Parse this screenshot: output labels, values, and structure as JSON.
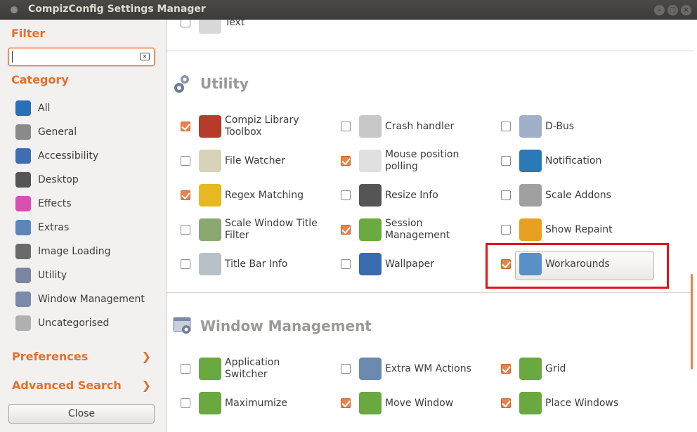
{
  "window": {
    "title": "CompizConfig Settings Manager",
    "buttons": {
      "minimize": "–",
      "maximize": "□",
      "close": "×"
    }
  },
  "sidebar": {
    "filter_heading": "Filter",
    "filter_value": "",
    "category_heading": "Category",
    "categories": [
      {
        "label": "All",
        "icon": "globe-icon",
        "color": "#2a6fb8"
      },
      {
        "label": "General",
        "icon": "gear-icon",
        "color": "#8a8a8a"
      },
      {
        "label": "Accessibility",
        "icon": "accessibility-icon",
        "color": "#3d6fb0"
      },
      {
        "label": "Desktop",
        "icon": "desktop-icon",
        "color": "#555555"
      },
      {
        "label": "Effects",
        "icon": "effects-icon",
        "color": "#d850b0"
      },
      {
        "label": "Extras",
        "icon": "extras-icon",
        "color": "#5a86b8"
      },
      {
        "label": "Image Loading",
        "icon": "image-loading-icon",
        "color": "#6a6a6a"
      },
      {
        "label": "Utility",
        "icon": "utility-icon",
        "color": "#7a86a0"
      },
      {
        "label": "Window Management",
        "icon": "window-management-icon",
        "color": "#7a8aa8"
      },
      {
        "label": "Uncategorised",
        "icon": "question-icon",
        "color": "#b0b0b0"
      }
    ],
    "preferences_label": "Preferences",
    "advanced_search_label": "Advanced Search",
    "arrow_glyph": "❯",
    "close_label": "Close"
  },
  "main": {
    "top_item": {
      "label": "Text",
      "checked": false
    },
    "utility": {
      "title": "Utility",
      "items": [
        {
          "label": "Compiz Library Toolbox",
          "checked": true,
          "icon": "toolbox-icon",
          "color": "#b83a2a"
        },
        {
          "label": "Crash handler",
          "checked": false,
          "icon": "crash-handler-icon",
          "color": "#c8c8c8"
        },
        {
          "label": "D-Bus",
          "checked": false,
          "icon": "dbus-icon",
          "color": "#9fb0c8"
        },
        {
          "label": "File Watcher",
          "checked": false,
          "icon": "file-watcher-icon",
          "color": "#d8d2b8"
        },
        {
          "label": "Mouse position polling",
          "checked": true,
          "icon": "mouse-polling-icon",
          "color": "#e0e0e0"
        },
        {
          "label": "Notification",
          "checked": false,
          "icon": "info-icon",
          "color": "#2a7ab8"
        },
        {
          "label": "Regex Matching",
          "checked": true,
          "icon": "regex-icon",
          "color": "#e8b820"
        },
        {
          "label": "Resize Info",
          "checked": false,
          "icon": "resize-info-icon",
          "color": "#555555"
        },
        {
          "label": "Scale Addons",
          "checked": false,
          "icon": "scale-addons-icon",
          "color": "#a0a0a0"
        },
        {
          "label": "Scale Window Title Filter",
          "checked": false,
          "icon": "scale-filter-icon",
          "color": "#8aa870"
        },
        {
          "label": "Session Management",
          "checked": true,
          "icon": "session-icon",
          "color": "#6aaa40"
        },
        {
          "label": "Show Repaint",
          "checked": false,
          "icon": "show-repaint-icon",
          "color": "#e8a020"
        },
        {
          "label": "Title Bar Info",
          "checked": false,
          "icon": "root-icon",
          "color": "#b8c0c8"
        },
        {
          "label": "Wallpaper",
          "checked": false,
          "icon": "wallpaper-icon",
          "color": "#3a6ab0"
        },
        {
          "label": "Workarounds",
          "checked": true,
          "icon": "workarounds-icon",
          "color": "#5a90c8"
        }
      ]
    },
    "window_management": {
      "title": "Window Management",
      "items": [
        {
          "label": "Application Switcher",
          "checked": false,
          "icon": "app-switcher-icon",
          "color": "#6aa840"
        },
        {
          "label": "Extra WM Actions",
          "checked": false,
          "icon": "extra-wm-icon",
          "color": "#6a8ab0"
        },
        {
          "label": "Grid",
          "checked": true,
          "icon": "grid-icon",
          "color": "#6aa840"
        },
        {
          "label": "Maximumize",
          "checked": false,
          "icon": "maximumize-icon",
          "color": "#6aa840"
        },
        {
          "label": "Move Window",
          "checked": true,
          "icon": "move-window-icon",
          "color": "#6aa840"
        },
        {
          "label": "Place Windows",
          "checked": true,
          "icon": "place-windows-icon",
          "color": "#6aa840"
        }
      ]
    }
  }
}
